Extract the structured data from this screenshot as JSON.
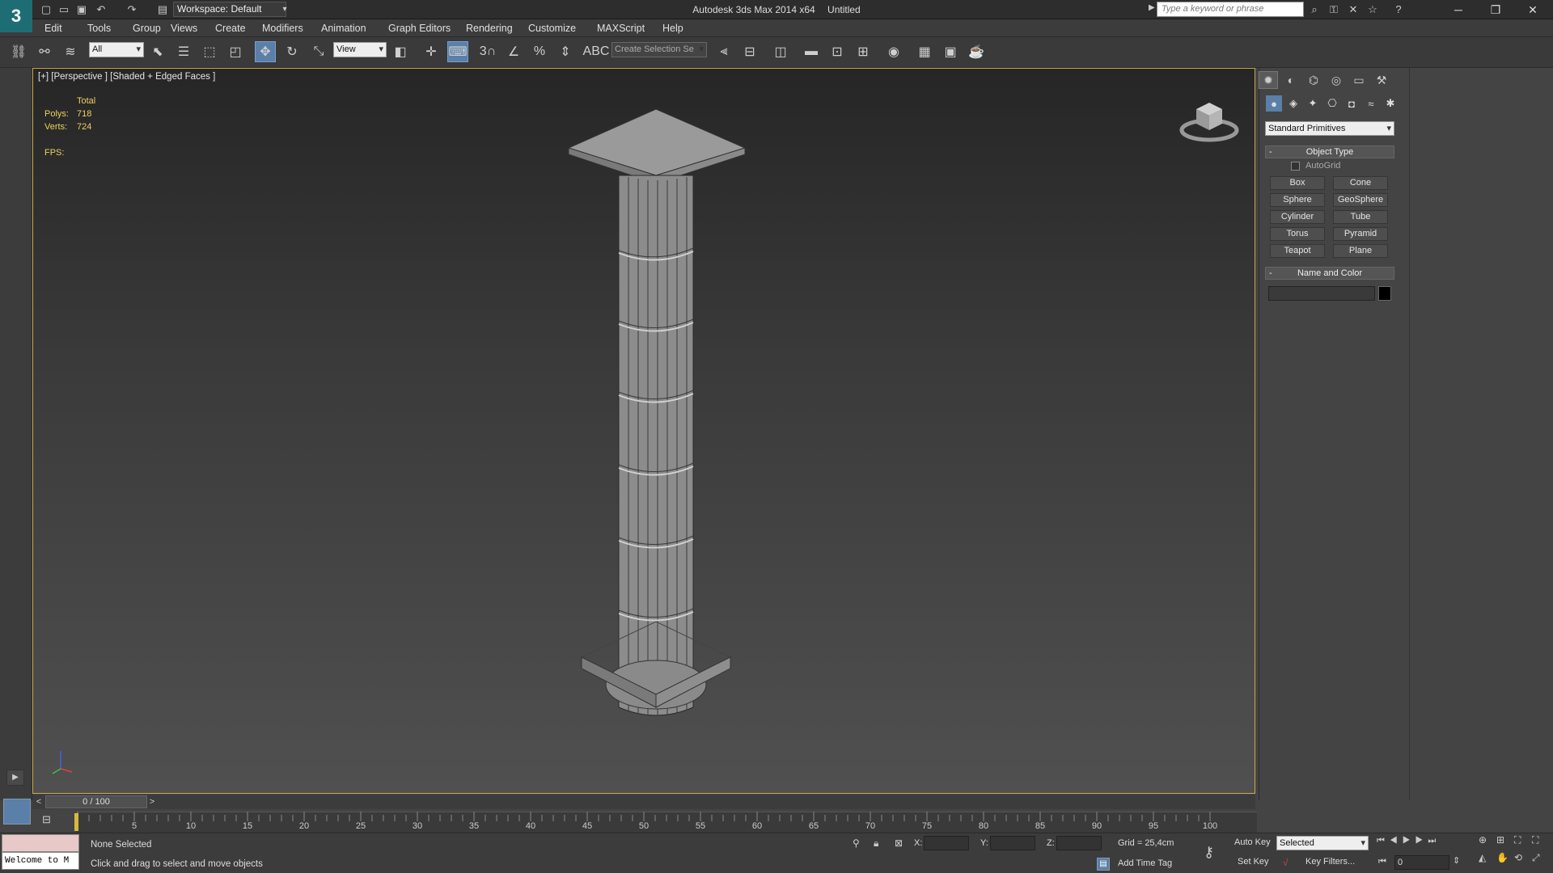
{
  "titlebar": {
    "app_title": "Autodesk 3ds Max  2014 x64",
    "doc_title": "Untitled",
    "workspace": "Workspace: Default",
    "search_placeholder": "Type a keyword or phrase"
  },
  "menu": [
    "Edit",
    "Tools",
    "Group",
    "Views",
    "Create",
    "Modifiers",
    "Animation",
    "Graph Editors",
    "Rendering",
    "Customize",
    "MAXScript",
    "Help"
  ],
  "toolbar": {
    "selection_filter": "All",
    "ref_coord": "View",
    "named_selection": "Create Selection Se",
    "snap_3": "3"
  },
  "viewport": {
    "label": "[+] [Perspective ] [Shaded + Edged Faces ]",
    "stats_total": "Total",
    "polys_label": "Polys:",
    "polys_value": "718",
    "verts_label": "Verts:",
    "verts_value": "724",
    "fps_label": "FPS:"
  },
  "command_panel": {
    "category": "Standard Primitives",
    "object_type_title": "Object Type",
    "autogrid_label": "AutoGrid",
    "autogrid_checked": false,
    "buttons": [
      "Box",
      "Cone",
      "Sphere",
      "GeoSphere",
      "Cylinder",
      "Tube",
      "Torus",
      "Pyramid",
      "Teapot",
      "Plane"
    ],
    "name_color_title": "Name and Color",
    "name_value": "",
    "color": "#000000"
  },
  "timeline": {
    "frame_display": "0 / 100",
    "ticks": [
      "5",
      "10",
      "15",
      "20",
      "25",
      "30",
      "35",
      "40",
      "45",
      "50",
      "55",
      "60",
      "65",
      "70",
      "75",
      "80",
      "85",
      "90",
      "95",
      "100"
    ],
    "prev": "<",
    "next": ">"
  },
  "status": {
    "maxscript_listener": "Welcome to M",
    "selection_status": "None Selected",
    "prompt": "Click and drag to select and move objects",
    "x_label": "X:",
    "y_label": "Y:",
    "z_label": "Z:",
    "grid": "Grid = 25,4cm",
    "add_time_tag": "Add Time Tag",
    "auto_key": "Auto Key",
    "set_key": "Set Key",
    "key_mode": "Selected",
    "key_filters": "Key Filters...",
    "current_frame": "0"
  },
  "colors": {
    "viewport_border": "#c8a94a",
    "active_tool": "#5a7fa8",
    "stats_text": "#f0d060"
  }
}
